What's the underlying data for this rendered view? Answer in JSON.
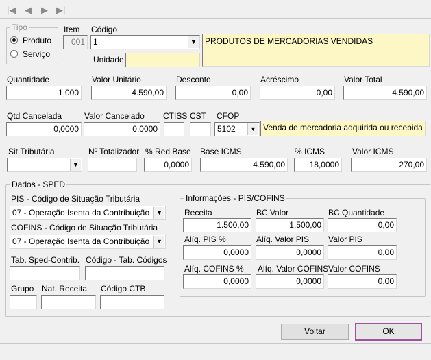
{
  "toolbar": {
    "nav_first": "|◀",
    "nav_prev": "◀",
    "nav_next": "▶",
    "nav_last": "▶|"
  },
  "tipo": {
    "title": "Tipo",
    "option_produto": "Produto",
    "option_servico": "Serviço",
    "selected": "Produto"
  },
  "item": {
    "label": "Item",
    "value": "001"
  },
  "codigo": {
    "label": "Código",
    "value": "1",
    "description": "PRODUTOS DE MERCADORIAS VENDIDAS"
  },
  "unidade": {
    "label": "Unidade",
    "value": ""
  },
  "quantidade": {
    "label": "Quantidade",
    "value": "1,000"
  },
  "valor_unitario": {
    "label": "Valor Unitário",
    "value": "4.590,00"
  },
  "desconto": {
    "label": "Desconto",
    "value": "0,00"
  },
  "acrescimo": {
    "label": "Acréscimo",
    "value": "0,00"
  },
  "valor_total": {
    "label": "Valor Total",
    "value": "4.590,00"
  },
  "qtd_cancelada": {
    "label": "Qtd Cancelada",
    "value": "0,0000"
  },
  "valor_cancelado": {
    "label": "Valor Cancelado",
    "value": "0,0000"
  },
  "ctiss": {
    "label": "CTISS",
    "value": ""
  },
  "cst": {
    "label": "CST",
    "value": ""
  },
  "cfop": {
    "label": "CFOP",
    "value": "5102",
    "description": "Venda de mercadoria adquirida ou recebida"
  },
  "sit_tributaria": {
    "label": "Sit.Tributária",
    "value": ""
  },
  "n_totalizador": {
    "label": "Nº Totalizador",
    "value": ""
  },
  "red_base": {
    "label": "% Red.Base",
    "value": "0,0000"
  },
  "base_icms": {
    "label": "Base ICMS",
    "value": "4.590,00"
  },
  "pct_icms": {
    "label": "% ICMS",
    "value": "18,0000"
  },
  "valor_icms": {
    "label": "Valor ICMS",
    "value": "270,00"
  },
  "sped": {
    "title": "Dados - SPED",
    "pis_label": "PIS -  Código de Situação Tributária",
    "pis_value": "07 - Operação Isenta da Contribuição",
    "cofins_label": "COFINS -  Código de Situação Tributária",
    "cofins_value": "07 - Operação Isenta da Contribuição",
    "tab_sped_label": "Tab. Sped-Contrib.",
    "tab_sped_value": "",
    "codigo_tab_label": "Código - Tab. Códigos",
    "codigo_tab_value": "",
    "grupo_label": "Grupo",
    "grupo_value": "",
    "nat_receita_label": "Nat. Receita",
    "nat_receita_value": "",
    "codigo_ctb_label": "Código CTB",
    "codigo_ctb_value": ""
  },
  "pis_cofins": {
    "title": "Informações - PIS/COFINS",
    "receita_label": "Receita",
    "receita_value": "1.500,00",
    "bc_valor_label": "BC Valor",
    "bc_valor_value": "1.500,00",
    "bc_qtd_label": "BC Quantidade",
    "bc_qtd_value": "0,00",
    "aliq_pis_label": "Alíq. PIS %",
    "aliq_pis_value": "0,0000",
    "aliq_valor_pis_label": "Alíq. Valor PIS",
    "aliq_valor_pis_value": "0,0000",
    "valor_pis_label": "Valor PIS",
    "valor_pis_value": "0,00",
    "aliq_cofins_label": "Alíq. COFINS %",
    "aliq_cofins_value": "0,0000",
    "aliq_valor_cofins_label": "Alíq. Valor COFINS",
    "aliq_valor_cofins_value": "0,0000",
    "valor_cofins_label": "Valor COFINS",
    "valor_cofins_value": "0,00"
  },
  "buttons": {
    "voltar": "Voltar",
    "ok": "OK"
  },
  "colors": {
    "ok_border": "#a050a0",
    "highlight_field": "#fdf7c5"
  }
}
